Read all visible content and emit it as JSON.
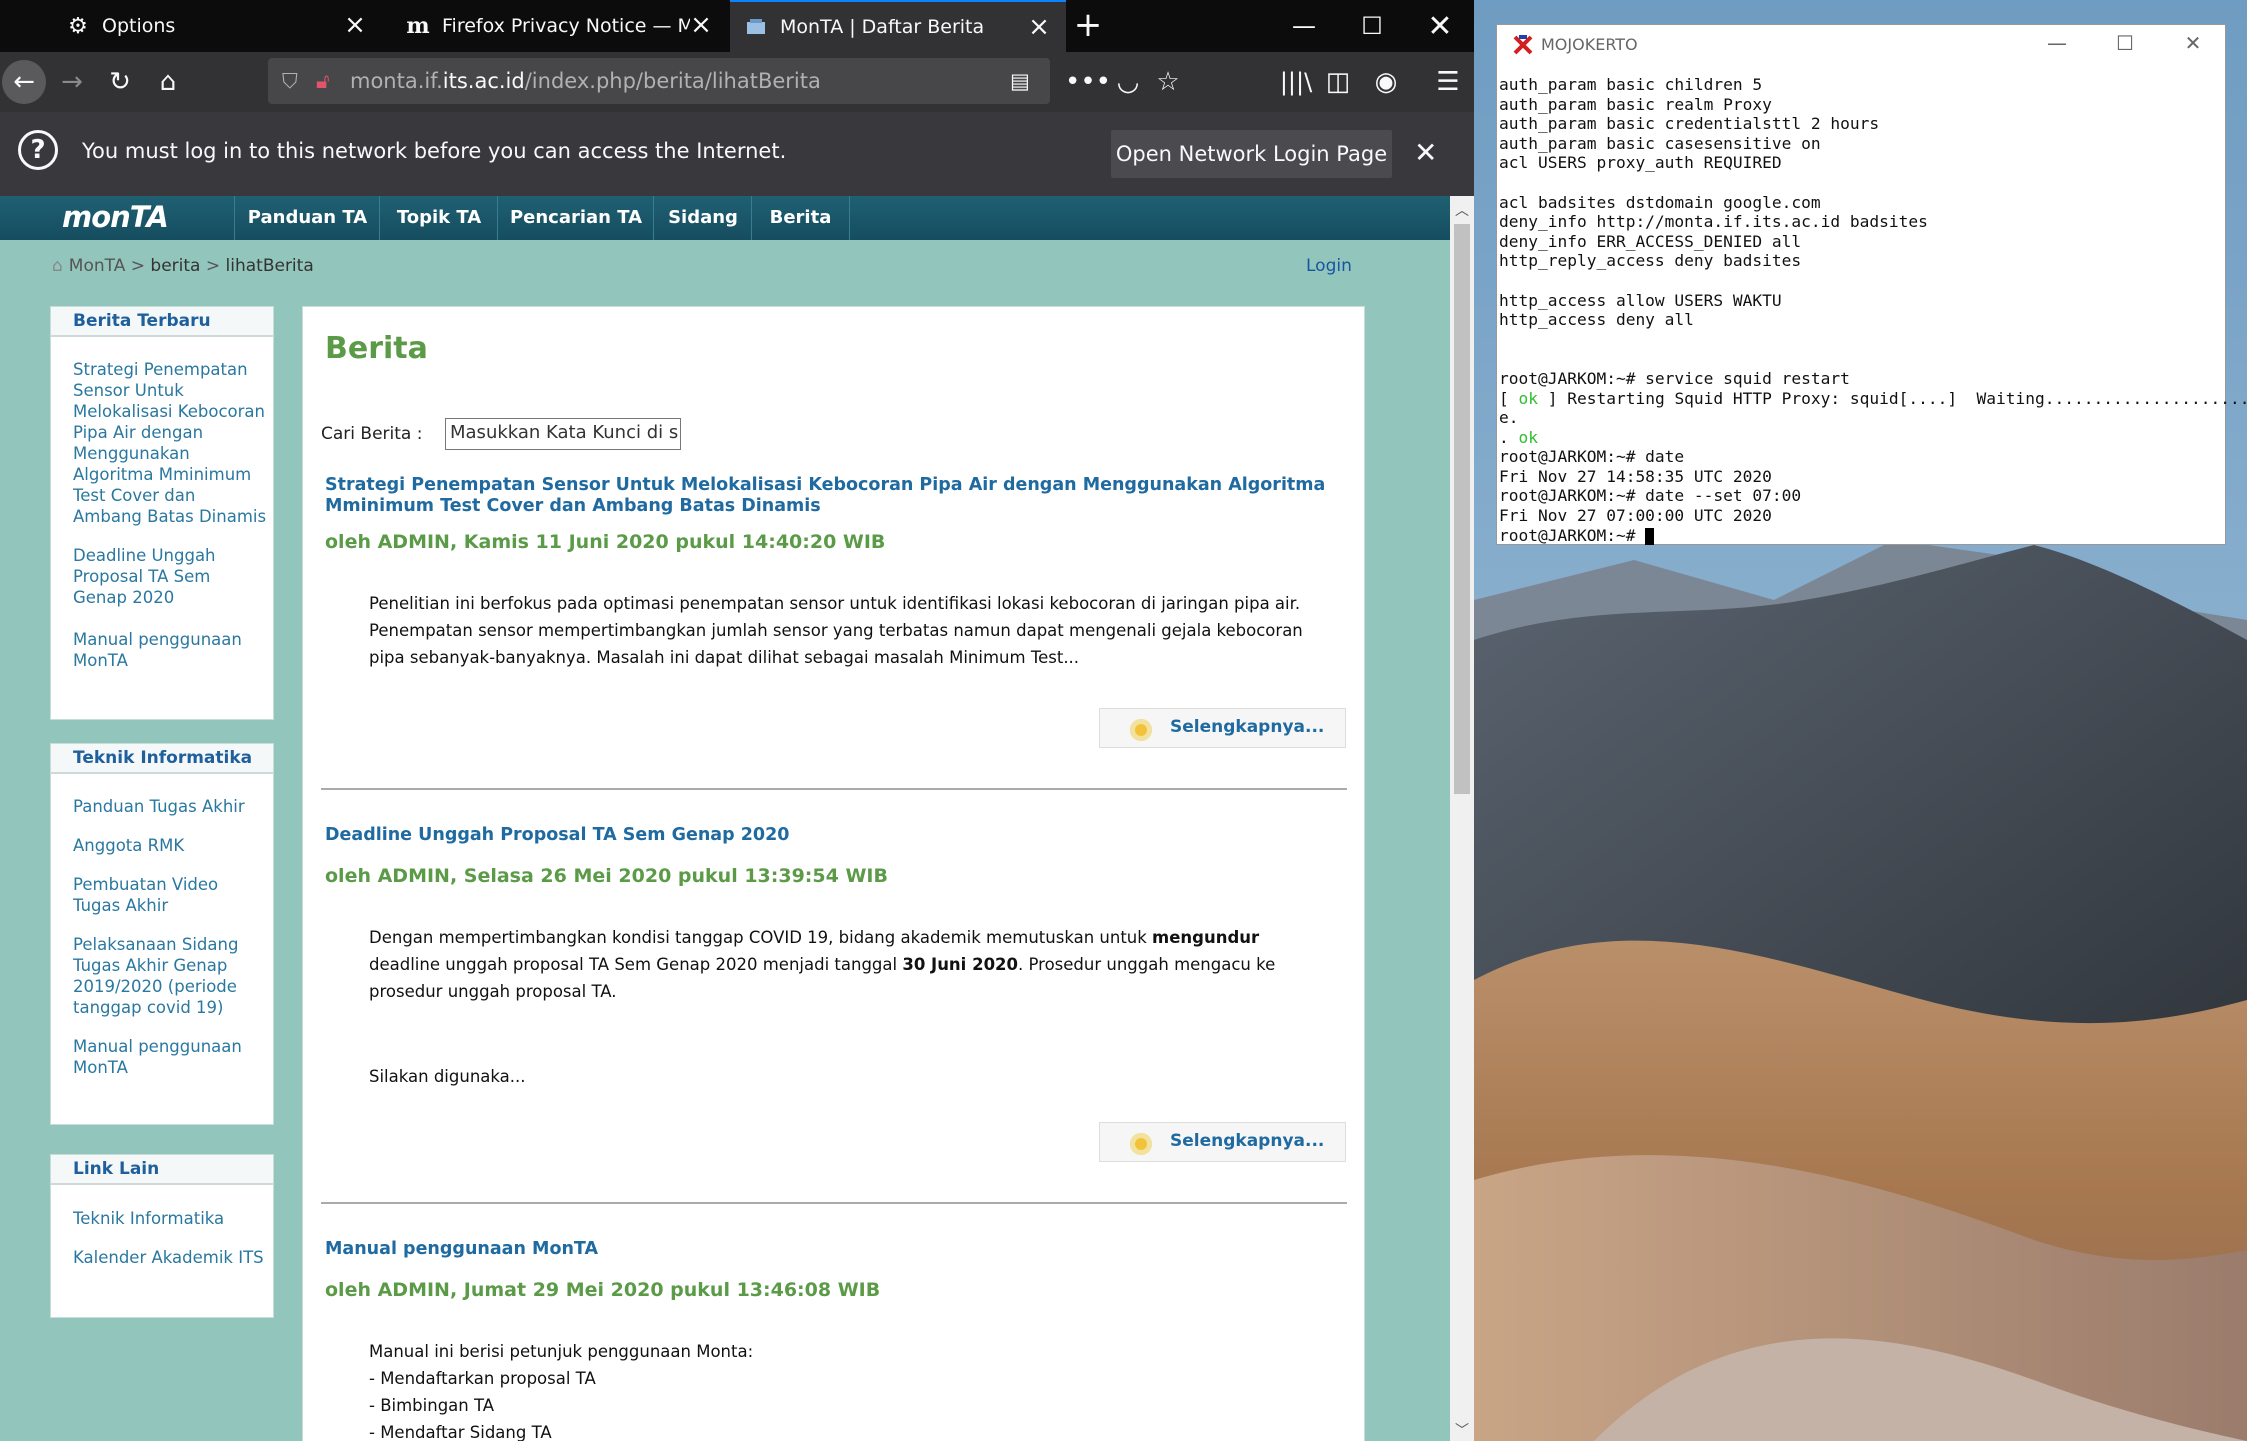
{
  "browser": {
    "tabs": [
      {
        "label": "Options",
        "icon": "gear-icon"
      },
      {
        "label": "Firefox Privacy Notice — Mozilla",
        "icon": "mozilla-m-icon"
      },
      {
        "label": "MonTA | Daftar Berita",
        "icon": "site-icon"
      }
    ],
    "url": {
      "prefix": "monta.if.",
      "host": "its.ac.id",
      "path": "/index.php/berita/lihatBerita"
    },
    "notification": {
      "message": "You must log in to this network before you can access the Internet.",
      "button": "Open Network Login Page"
    }
  },
  "site": {
    "logo": "monTA",
    "menu": [
      "Panduan TA",
      "Topik TA",
      "Pencarian TA",
      "Sidang",
      "Berita"
    ],
    "breadcrumb": {
      "home": "MonTA",
      "sep": " > ",
      "section": "berita",
      "page": "lihatBerita"
    },
    "login": "Login",
    "sidebar": {
      "berita_terbaru": {
        "title": "Berita Terbaru",
        "items": [
          "Strategi Penempatan Sensor Untuk Melokalisasi Kebocoran Pipa Air dengan Menggunakan Algoritma Mminimum Test Cover dan Ambang Batas Dinamis",
          "Deadline Unggah Proposal TA Sem Genap 2020",
          "Manual penggunaan MonTA"
        ]
      },
      "teknik_informatika": {
        "title": "Teknik Informatika",
        "items": [
          "Panduan Tugas Akhir",
          "Anggota RMK",
          "Pembuatan Video Tugas Akhir",
          "Pelaksanaan Sidang Tugas Akhir Genap 2019/2020 (periode tanggap covid 19)",
          "Manual penggunaan MonTA"
        ]
      },
      "link_lain": {
        "title": "Link Lain",
        "items": [
          "Teknik Informatika",
          "Kalender Akademik ITS"
        ]
      }
    },
    "content": {
      "title": "Berita",
      "search_label": "Cari Berita :",
      "search_value": "Masukkan Kata Kunci di s",
      "more_label": "Selengkapnya...",
      "articles": [
        {
          "title": "Strategi Penempatan Sensor Untuk Melokalisasi Kebocoran Pipa Air dengan Menggunakan Algoritma Mminimum Test Cover dan Ambang Batas Dinamis",
          "meta": "oleh ADMIN, Kamis 11 Juni 2020 pukul 14:40:20 WIB",
          "body": "Penelitian ini berfokus pada optimasi penempatan sensor untuk identifikasi lokasi kebocoran di jaringan pipa air. Penempatan sensor mempertimbangkan jumlah sensor yang terbatas namun dapat mengenali gejala kebocoran pipa sebanyak-banyaknya. Masalah ini dapat dilihat sebagai masalah Minimum Test..."
        },
        {
          "title": "Deadline Unggah Proposal TA Sem Genap 2020",
          "meta": "oleh ADMIN, Selasa 26 Mei 2020 pukul 13:39:54 WIB",
          "body_a": "Dengan mempertimbangkan kondisi tanggap COVID 19, bidang akademik memutuskan untuk ",
          "body_b": "mengundur",
          "body_c": " deadline unggah proposal TA Sem Genap 2020 menjadi tanggal ",
          "body_d": "30 Juni 2020",
          "body_e": ". Prosedur unggah mengacu ke prosedur unggah proposal TA.",
          "body_2": "Silakan digunaka..."
        },
        {
          "title": "Manual penggunaan MonTA",
          "meta": "oleh ADMIN, Jumat 29 Mei 2020 pukul 13:46:08 WIB",
          "lines": [
            "Manual ini berisi petunjuk penggunaan Monta:",
            "- Mendaftarkan proposal TA",
            "- Bimbingan TA",
            "- Mendaftar Sidang TA"
          ]
        }
      ]
    }
  },
  "terminal": {
    "title": "MOJOKERTO",
    "lines": [
      "auth_param basic children 5",
      "auth_param basic realm Proxy",
      "auth_param basic credentialsttl 2 hours",
      "auth_param basic casesensitive on",
      "acl USERS proxy_auth REQUIRED",
      "",
      "acl badsites dstdomain google.com",
      "deny_info http://monta.if.its.ac.id badsites",
      "deny_info ERR_ACCESS_DENIED all",
      "http_reply_access deny badsites",
      "",
      "http_access allow USERS WAKTU",
      "http_access deny all",
      "",
      "",
      "root@JARKOM:~# service squid restart"
    ],
    "restart_a": "[ ",
    "ok": "ok",
    "restart_b": " ] Restarting Squid HTTP Proxy: squid[....]  Waiting......................don",
    "restart_c": "e.",
    "dot_ok_a": ". ",
    "lines2": [
      "root@JARKOM:~# date",
      "Fri Nov 27 14:58:35 UTC 2020",
      "root@JARKOM:~# date --set 07:00",
      "Fri Nov 27 07:00:00 UTC 2020"
    ],
    "prompt": "root@JARKOM:~# "
  }
}
